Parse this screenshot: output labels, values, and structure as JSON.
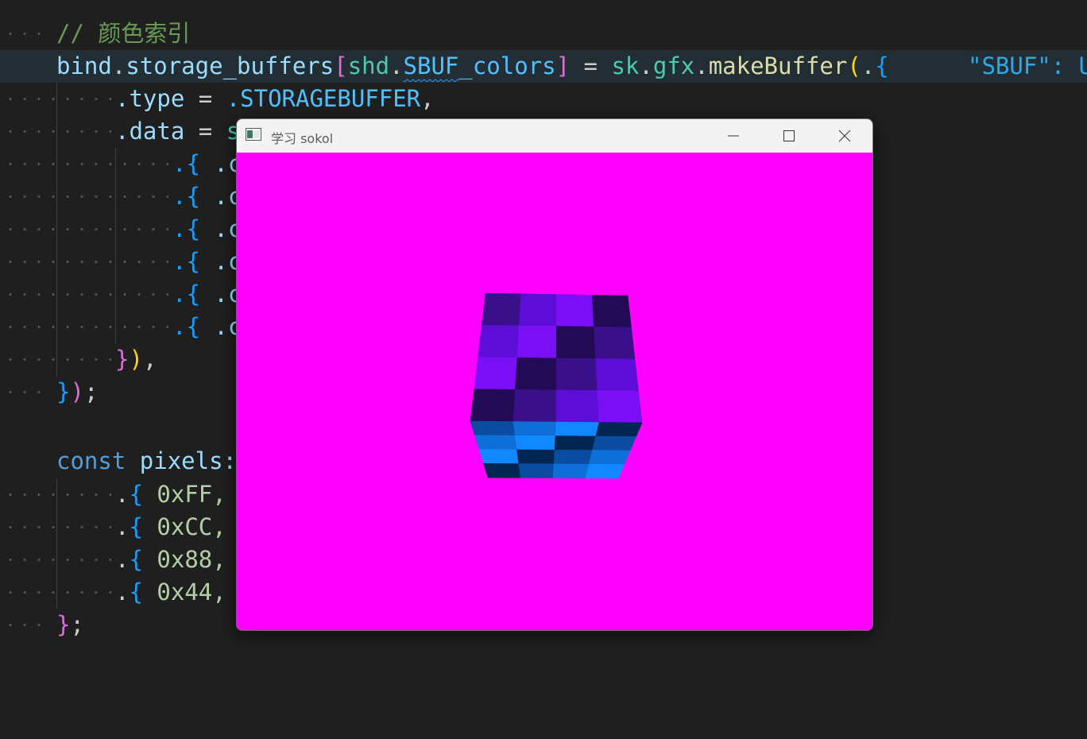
{
  "editor": {
    "line_comment": "// 颜色索引",
    "bind_obj": "bind",
    "bind_field": "storage_buffers",
    "shd_ns": "shd",
    "sbuf_name": "SBUF",
    "sbuf_suffix": "_colors",
    "sk_ns": "sk",
    "gfx_ns": "gfx",
    "make_buffer": "makeBuffer",
    "inlay_hint": "\"SBUF\": U",
    "type_field": ".type",
    "storage_enum": ".STORAGEBUFFER",
    "data_field": ".data",
    "data_value_start": "s",
    "row_prefix": ".{",
    "row_field_start": ".c",
    "const_kw": "const",
    "pixels_name": "pixels:",
    "pixel_values": [
      "0xFF,",
      "0xCC,",
      "0x88,",
      "0x44,"
    ]
  },
  "app_window": {
    "title": "学习 sokol",
    "clear_color": "#ff00ff",
    "icons": [
      "app-icon",
      "minimize-icon",
      "maximize-icon",
      "close-icon"
    ],
    "cube": {
      "front_face_colors": [
        [
          "#3a0f8a",
          "#5d0ed6",
          "#7a0ff5",
          "#230a55"
        ],
        [
          "#5d0ed6",
          "#7a0ff5",
          "#230a55",
          "#3a0f8a"
        ],
        [
          "#7a0ff5",
          "#230a55",
          "#3a0f8a",
          "#5d0ed6"
        ],
        [
          "#230a55",
          "#3a0f8a",
          "#5d0ed6",
          "#7a0ff5"
        ]
      ],
      "bottom_face_colors": [
        [
          "#0a4da0",
          "#0f6fd8",
          "#1188ff",
          "#032552"
        ],
        [
          "#0f6fd8",
          "#1188ff",
          "#032552",
          "#0a4da0"
        ],
        [
          "#1188ff",
          "#032552",
          "#0a4da0",
          "#0f6fd8"
        ],
        [
          "#032552",
          "#0a4da0",
          "#0f6fd8",
          "#1188ff"
        ]
      ]
    }
  }
}
